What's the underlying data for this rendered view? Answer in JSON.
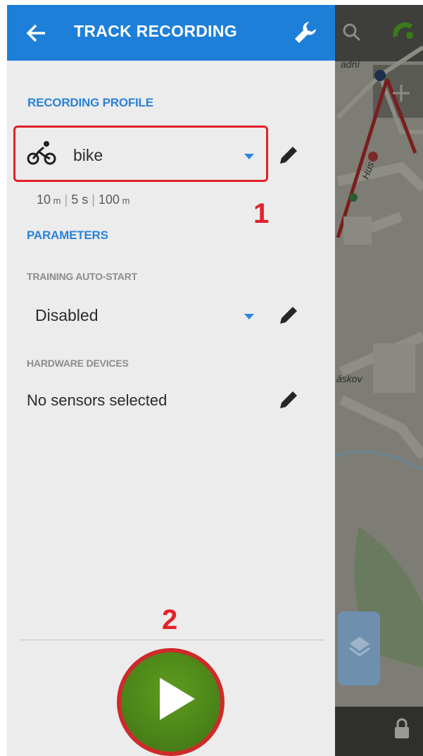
{
  "appbar": {
    "title": "TRACK RECORDING",
    "back_icon": "arrow-left-icon",
    "settings_icon": "wrench-icon"
  },
  "recording_profile": {
    "section_title": "RECORDING PROFILE",
    "selected_profile": "bike",
    "profile_icon": "bicycle-icon",
    "summary": {
      "distance": "10",
      "distance_unit": "m",
      "time": "5 s",
      "accuracy": "100",
      "accuracy_unit": "m"
    }
  },
  "parameters": {
    "section_title": "PARAMETERS",
    "training_autostart": {
      "label": "TRAINING AUTO-START",
      "value": "Disabled"
    },
    "hardware_devices": {
      "label": "HARDWARE DEVICES",
      "value": "No sensors selected"
    }
  },
  "annotations": {
    "marker_1": "1",
    "marker_2": "2"
  },
  "map": {
    "street_labels": [
      "adní",
      "Hus",
      "áskov"
    ],
    "icons": [
      "search-icon",
      "gps-icon",
      "plus-icon",
      "layers-icon",
      "lock-icon"
    ]
  },
  "colors": {
    "appbar": "#1e7fd8",
    "accent": "#2a82d9",
    "highlight": "#e3212a",
    "play": "#4b8419",
    "drawer_bg": "#ececec"
  }
}
